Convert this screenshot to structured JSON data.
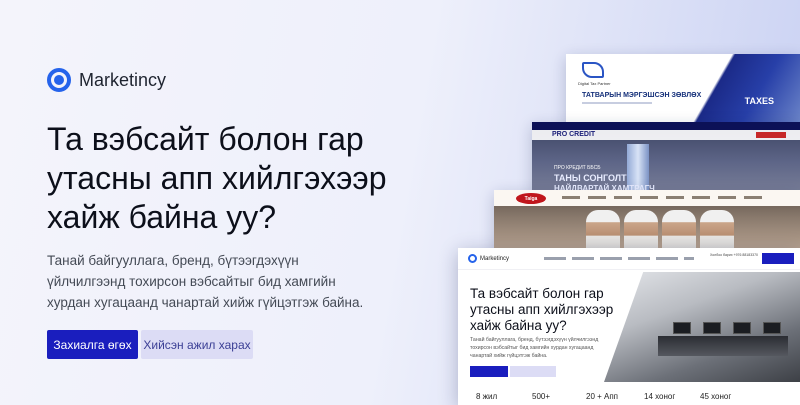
{
  "brand": {
    "name": "Marketincy",
    "accent": "#2563eb"
  },
  "hero": {
    "headline": "Та вэбсайт болон гар утасны апп хийлгэхээр хайж байна уу?",
    "description": "Танай байгууллага, бренд, бүтээгдэхүүн үйлчилгээнд тохирсон вэбсайтыг бид хамгийн хурдан хугацаанд чанартай хийж гүйцэтгэж байна.",
    "primary_button": "Захиалга өгөх",
    "secondary_button": "Хийсэн ажил харах",
    "primary_color": "#1a1ebe",
    "secondary_color": "#dcdcf5"
  },
  "portfolio": {
    "card1": {
      "title": "ТАТВАРЫН МЭРГЭШСЭН ЗӨВЛӨХ",
      "subtitle": "Digital Tax Partner",
      "tag": "TAXES"
    },
    "card2": {
      "brand": "PRO CREDIT",
      "line1": "ПРО КРЕДИТ ББСБ",
      "line2": "ТАНЫ СОНГОЛТ",
      "line3": "НАЙДВАРТАЙ ХАМТРАГЧ"
    },
    "card3": {
      "badge": "Taiga"
    },
    "card4": {
      "brand": "Marketincy",
      "contact": "Холбоо барих  +976 88183370",
      "headline": "Та вэбсайт болон гар утасны апп хийлгэхээр хайж байна уу?",
      "description": "Танай байгууллага, бренд, бүтээгдэхүүн үйлчилгээнд тохирсон вэбсайтыг бид хамгийн хурдан хугацаанд чанартай хийж гүйцэтгэж байна.",
      "stats": [
        "8 жил",
        "500+",
        "20 + Апп",
        "14 хоног",
        "45 хоног"
      ]
    }
  }
}
